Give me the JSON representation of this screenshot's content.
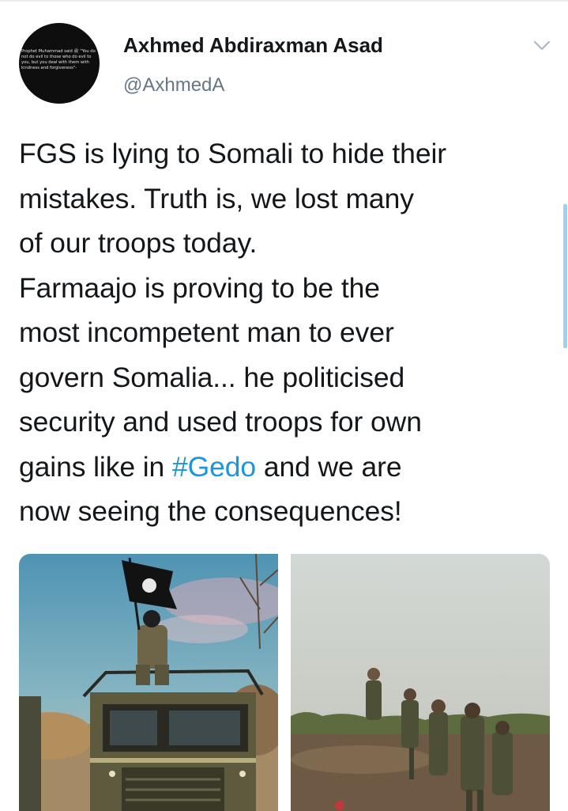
{
  "author": {
    "name": "Axhmed Abdiraxman Asad",
    "handle": "@AxhmedA",
    "avatar_quote": "Prophet Muhammad said ﷺ \"You do not do evil to those who do evil to you, but you deal with them with kindness and forgiveness\"-"
  },
  "tweet": {
    "text_before": "FGS is lying to Somali to hide their\nmistakes. Truth is, we lost many\nof our troops today.\nFarmaajo is proving to be the\nmost incompetent man to ever\ngovern Somalia... he politicised\nsecurity and used troops for own\ngains like in ",
    "hashtag": "#Gedo",
    "text_after": " and we are\nnow seeing the consequences!"
  },
  "icons": {
    "more": "chevron-down-icon"
  },
  "colors": {
    "hashtag": "#1b95e0",
    "text": "#14171a",
    "secondary": "#657786"
  }
}
